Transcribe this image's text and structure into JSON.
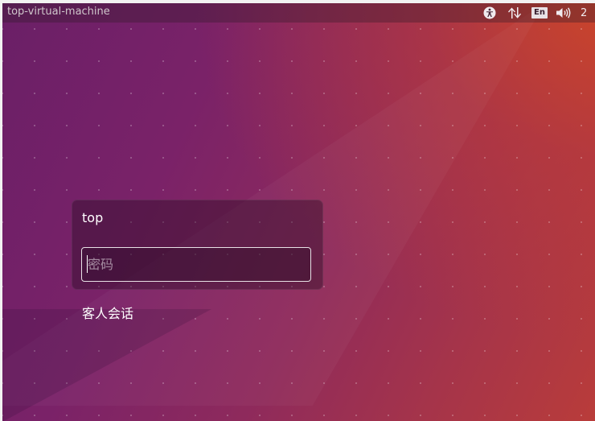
{
  "topbar": {
    "hostname": "top-virtual-machine",
    "indicators": [
      {
        "name": "accessibility-icon"
      },
      {
        "name": "network-transfer-icon"
      },
      {
        "name": "keyboard-layout",
        "label": "En"
      },
      {
        "name": "volume-icon"
      }
    ],
    "clock_partial": "2"
  },
  "login": {
    "username": "top",
    "password_placeholder": "密码",
    "guest_session_label": "客人会话"
  },
  "colors": {
    "background_start": "#6a1f67",
    "background_end": "#c0413a",
    "card_bg": "rgba(40,12,35,0.42)",
    "text": "#ffffff"
  }
}
